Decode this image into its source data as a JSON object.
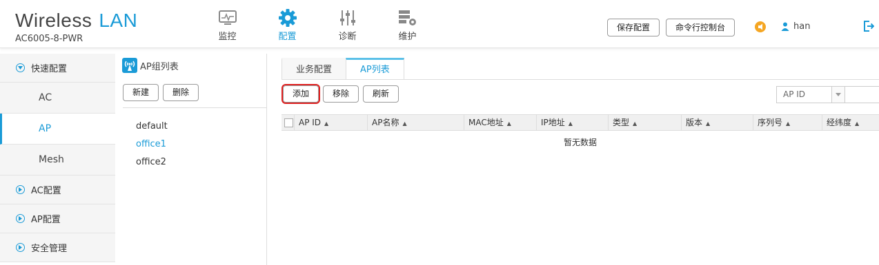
{
  "app": {
    "title": "Wireless",
    "title_accent": "LAN",
    "device": "AC6005-8-PWR"
  },
  "nav": [
    {
      "label": "监控",
      "icon": "monitor-icon",
      "active": false
    },
    {
      "label": "配置",
      "icon": "gear-icon",
      "active": true
    },
    {
      "label": "诊断",
      "icon": "sliders-icon",
      "active": false
    },
    {
      "label": "维护",
      "icon": "server-gear-icon",
      "active": false
    }
  ],
  "header": {
    "save_label": "保存配置",
    "cli_label": "命令行控制台",
    "user": "han"
  },
  "sidebar": {
    "quick_config": "快速配置",
    "sub": [
      "AC",
      "AP",
      "Mesh"
    ],
    "ac_config": "AC配置",
    "ap_config": "AP配置",
    "security": "安全管理"
  },
  "group_panel": {
    "title": "AP组列表",
    "new_label": "新建",
    "delete_label": "删除",
    "groups": [
      "default",
      "office1",
      "office2"
    ],
    "selected": "office1"
  },
  "main": {
    "tabs": [
      "业务配置",
      "AP列表"
    ],
    "active_tab": "AP列表",
    "toolbar": {
      "add_label": "添加",
      "remove_label": "移除",
      "refresh_label": "刷新"
    },
    "filter": {
      "selected": "AP ID"
    },
    "columns": [
      "AP ID",
      "AP名称",
      "MAC地址",
      "IP地址",
      "类型",
      "版本",
      "序列号",
      "经纬度"
    ],
    "empty_text": "暂无数据"
  },
  "colors": {
    "accent": "#1a9bd7",
    "highlight": "#e02020",
    "notice": "#f5a623"
  }
}
